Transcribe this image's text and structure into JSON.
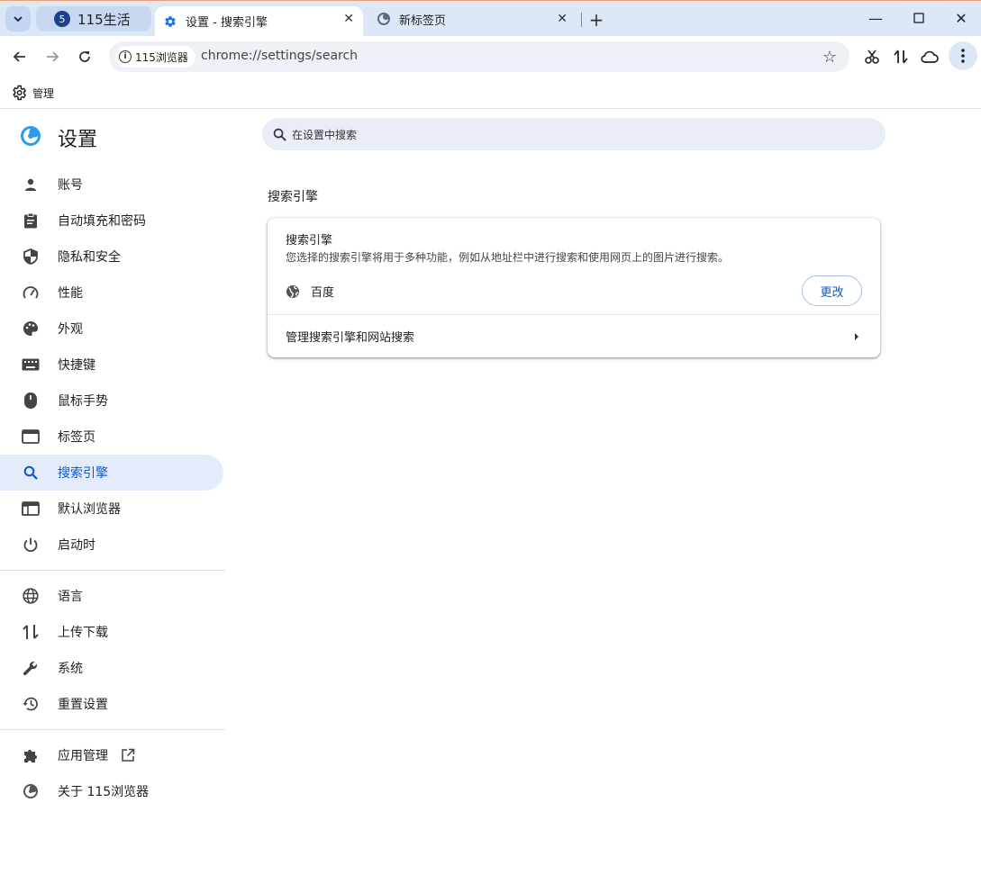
{
  "browser": {
    "tabs": [
      {
        "label": "115生活",
        "icon": "115-logo-icon"
      },
      {
        "label": "设置 - 搜索引擎",
        "icon": "gear-icon",
        "active": true
      },
      {
        "label": "新标签页",
        "icon": "browser-logo-icon"
      }
    ],
    "site_chip": "115浏览器",
    "url": "chrome://settings/search",
    "bookmark": "管理"
  },
  "sidebar": {
    "title": "设置",
    "groups": [
      [
        {
          "label": "账号",
          "icon": "person-icon"
        },
        {
          "label": "自动填充和密码",
          "icon": "clipboard-icon"
        },
        {
          "label": "隐私和安全",
          "icon": "shield-icon"
        },
        {
          "label": "性能",
          "icon": "speedometer-icon"
        },
        {
          "label": "外观",
          "icon": "palette-icon"
        },
        {
          "label": "快捷键",
          "icon": "keyboard-icon"
        },
        {
          "label": "鼠标手势",
          "icon": "mouse-icon"
        },
        {
          "label": "标签页",
          "icon": "tab-window-icon"
        },
        {
          "label": "搜索引擎",
          "icon": "search-icon",
          "selected": true
        },
        {
          "label": "默认浏览器",
          "icon": "browser-window-icon"
        },
        {
          "label": "启动时",
          "icon": "power-icon"
        }
      ],
      [
        {
          "label": "语言",
          "icon": "globe-icon"
        },
        {
          "label": "上传下载",
          "icon": "up-down-arrows-icon"
        },
        {
          "label": "系统",
          "icon": "wrench-icon"
        },
        {
          "label": "重置设置",
          "icon": "history-icon"
        }
      ],
      [
        {
          "label": "应用管理",
          "icon": "puzzle-icon"
        },
        {
          "label": "关于 115浏览器",
          "icon": "browser-logo-icon"
        }
      ]
    ]
  },
  "main": {
    "search_placeholder": "在设置中搜索",
    "section_title": "搜索引擎",
    "card": {
      "heading": "搜索引擎",
      "description": "您选择的搜索引擎将用于多种功能，例如从地址栏中进行搜索和使用网页上的图片进行搜索。",
      "engine_name": "百度",
      "change_label": "更改",
      "manage_label": "管理搜索引擎和网站搜索"
    }
  },
  "colors": {
    "accent": "#0b57d0",
    "selected_bg": "#e4ecfb",
    "tabstrip_bg": "#dce7f8"
  }
}
